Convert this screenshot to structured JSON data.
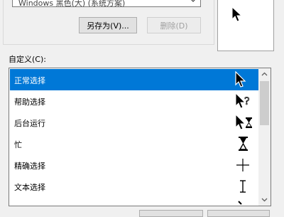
{
  "scheme": {
    "value": "Windows 黑色(大) (系统方案)"
  },
  "buttons": {
    "save_as": "另存为(V)...",
    "delete": "删除(D)"
  },
  "custom_label": "自定义(C):",
  "cursor_list": [
    {
      "label": "正常选择",
      "icon": "arrow-cursor-icon",
      "selected": true
    },
    {
      "label": "帮助选择",
      "icon": "help-cursor-icon",
      "selected": false
    },
    {
      "label": "后台运行",
      "icon": "working-in-background-cursor-icon",
      "selected": false
    },
    {
      "label": "忙",
      "icon": "busy-hourglass-cursor-icon",
      "selected": false
    },
    {
      "label": "精确选择",
      "icon": "precision-crosshair-cursor-icon",
      "selected": false
    },
    {
      "label": "文本选择",
      "icon": "text-ibeam-cursor-icon",
      "selected": false
    }
  ],
  "colors": {
    "selection": "#0078d7",
    "window_bg": "#f0f0f0"
  }
}
